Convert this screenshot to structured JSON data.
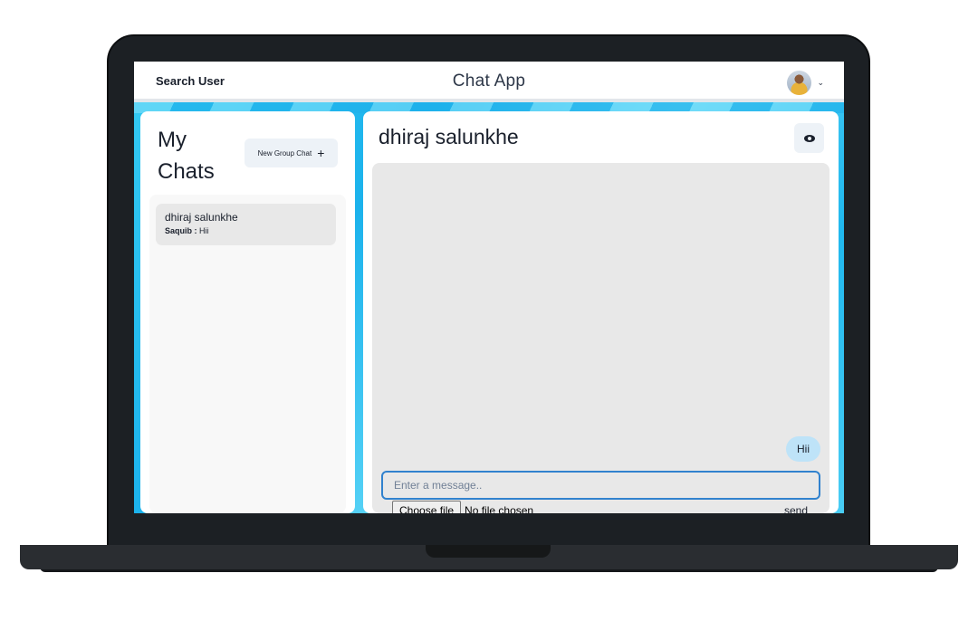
{
  "header": {
    "search_label": "Search User",
    "app_title": "Chat App",
    "avatar_icon": "user-avatar",
    "menu_icon": "chevron-down-icon"
  },
  "my_chats": {
    "title": "My Chats",
    "new_group_label": "New Group Chat",
    "new_group_icon": "plus-icon",
    "chats": [
      {
        "name": "dhiraj salunkhe",
        "latest_sender": "Saquib :",
        "latest_message": "Hii"
      }
    ]
  },
  "chatbox": {
    "title": "dhiraj salunkhe",
    "view_icon": "eye-icon",
    "messages": [
      {
        "text": "Hii",
        "from_self": true
      }
    ],
    "input_placeholder": "Enter a message..",
    "file_button_label": "Choose file",
    "file_status": "No file chosen",
    "send_label": "send"
  },
  "colors": {
    "accent": "#3182ce",
    "bubble_self": "#bee3f8",
    "background": "#1bb2ec"
  }
}
